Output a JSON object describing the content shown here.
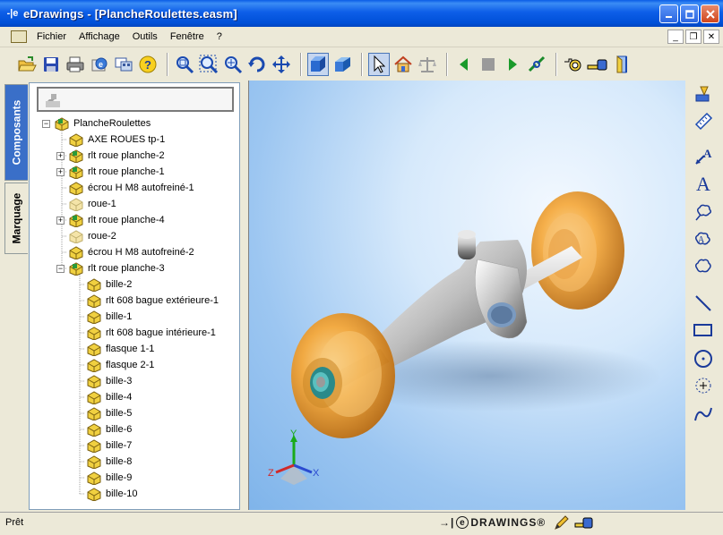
{
  "window": {
    "app_icon_label": "-|e",
    "title": "eDrawings - [PlancheRoulettes.easm]",
    "controls": [
      "minimize",
      "maximize",
      "close"
    ]
  },
  "menu": {
    "items": [
      "Fichier",
      "Affichage",
      "Outils",
      "Fenêtre",
      "?"
    ]
  },
  "toolbar": {
    "buttons": [
      "open-icon",
      "save-icon",
      "print-icon",
      "send-icon",
      "options-icon",
      "help-icon",
      "zoom-fit-icon",
      "zoom-area-icon",
      "zoom-icon",
      "rotate-icon",
      "pan-icon",
      "shaded-view-icon",
      "perspective-icon",
      "select-icon",
      "home-view-icon",
      "measure-balance-icon",
      "previous-icon",
      "stop-icon",
      "play-icon",
      "explode-icon",
      "camera-icon",
      "tape-measure-icon",
      "section-icon"
    ]
  },
  "tabs": {
    "components": "Composants",
    "markup": "Marquage"
  },
  "tree": {
    "root": "PlancheRoulettes",
    "nodes": [
      {
        "label": "AXE ROUES tp-1",
        "depth": 1,
        "expander": ""
      },
      {
        "label": "rlt roue planche-2",
        "depth": 1,
        "expander": "+"
      },
      {
        "label": "rlt roue planche-1",
        "depth": 1,
        "expander": "+"
      },
      {
        "label": "écrou H M8 autofreiné-1",
        "depth": 1,
        "expander": ""
      },
      {
        "label": "roue-1",
        "depth": 1,
        "expander": ""
      },
      {
        "label": "rlt roue planche-4",
        "depth": 1,
        "expander": "+"
      },
      {
        "label": "roue-2",
        "depth": 1,
        "expander": ""
      },
      {
        "label": "écrou H M8 autofreiné-2",
        "depth": 1,
        "expander": ""
      },
      {
        "label": "rlt roue planche-3",
        "depth": 1,
        "expander": "−"
      },
      {
        "label": "bille-2",
        "depth": 2,
        "expander": ""
      },
      {
        "label": "rlt 608 bague extérieure-1",
        "depth": 2,
        "expander": ""
      },
      {
        "label": "bille-1",
        "depth": 2,
        "expander": ""
      },
      {
        "label": "rlt 608 bague intérieure-1",
        "depth": 2,
        "expander": ""
      },
      {
        "label": "flasque 1-1",
        "depth": 2,
        "expander": ""
      },
      {
        "label": "flasque 2-1",
        "depth": 2,
        "expander": ""
      },
      {
        "label": "bille-3",
        "depth": 2,
        "expander": ""
      },
      {
        "label": "bille-4",
        "depth": 2,
        "expander": ""
      },
      {
        "label": "bille-5",
        "depth": 2,
        "expander": ""
      },
      {
        "label": "bille-6",
        "depth": 2,
        "expander": ""
      },
      {
        "label": "bille-7",
        "depth": 2,
        "expander": ""
      },
      {
        "label": "bille-8",
        "depth": 2,
        "expander": ""
      },
      {
        "label": "bille-9",
        "depth": 2,
        "expander": ""
      },
      {
        "label": "bille-10",
        "depth": 2,
        "expander": ""
      }
    ]
  },
  "viewport": {
    "axes": {
      "x": "X",
      "y": "Y",
      "z": "Z"
    }
  },
  "markup_toolbar": {
    "buttons": [
      "stamp-icon",
      "ruler-icon",
      "leader-text-icon",
      "text-icon",
      "cloud-leader-icon",
      "cloud-text-icon",
      "cloud-icon",
      "line-icon",
      "rectangle-icon",
      "circle-icon",
      "dimension-circle-icon",
      "spline-icon"
    ]
  },
  "status": {
    "text": "Prêt",
    "logo_arrow": "→|",
    "logo_e": "e",
    "logo_text": "DRAWINGS®"
  },
  "colors": {
    "titlebar": "#0d5ee8",
    "wheel": "#f0a030",
    "hub": "#40a0a0",
    "viewport_bg": "#b6d6f5"
  }
}
